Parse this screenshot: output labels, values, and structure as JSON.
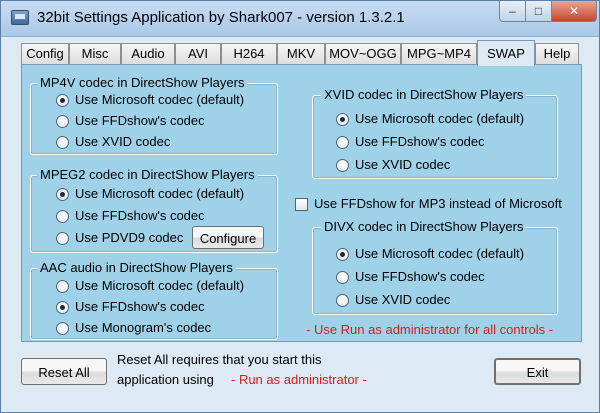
{
  "window": {
    "title": "32bit Settings Application by Shark007 - version 1.3.2.1",
    "minimize_glyph": "–",
    "maximize_glyph": "□",
    "close_glyph": "✕"
  },
  "tabs": [
    {
      "label": "Config",
      "active": false
    },
    {
      "label": "Misc",
      "active": false
    },
    {
      "label": "Audio",
      "active": false
    },
    {
      "label": "AVI",
      "active": false
    },
    {
      "label": "H264",
      "active": false
    },
    {
      "label": "MKV",
      "active": false
    },
    {
      "label": "MOV~OGG",
      "active": false
    },
    {
      "label": "MPG~MP4",
      "active": false
    },
    {
      "label": "SWAP",
      "active": true
    },
    {
      "label": "Help",
      "active": false
    }
  ],
  "mp4v": {
    "title": "MP4V codec in DirectShow Players",
    "options": [
      {
        "label": "Use Microsoft codec (default)",
        "checked": true
      },
      {
        "label": "Use FFDshow's codec",
        "checked": false
      },
      {
        "label": "Use XVID codec",
        "checked": false
      }
    ]
  },
  "mpeg2": {
    "title": "MPEG2 codec in DirectShow Players",
    "options": [
      {
        "label": "Use Microsoft codec (default)",
        "checked": true
      },
      {
        "label": "Use FFDshow's codec",
        "checked": false
      },
      {
        "label": "Use PDVD9 codec",
        "checked": false
      }
    ],
    "configure_label": "Configure"
  },
  "aac": {
    "title": "AAC audio in DirectShow Players",
    "options": [
      {
        "label": "Use Microsoft codec (default)",
        "checked": false
      },
      {
        "label": "Use FFDshow's codec",
        "checked": true
      },
      {
        "label": "Use Monogram's codec",
        "checked": false
      }
    ]
  },
  "xvid": {
    "title": "XVID codec in DirectShow Players",
    "options": [
      {
        "label": "Use Microsoft codec (default)",
        "checked": true
      },
      {
        "label": "Use FFDshow's codec",
        "checked": false
      },
      {
        "label": "Use XVID codec",
        "checked": false
      }
    ]
  },
  "mp3": {
    "label": "Use FFDshow for MP3 instead of Microsoft",
    "checked": false
  },
  "divx": {
    "title": "DIVX codec in DirectShow Players",
    "options": [
      {
        "label": "Use Microsoft codec (default)",
        "checked": true
      },
      {
        "label": "Use FFDshow's codec",
        "checked": false
      },
      {
        "label": "Use XVID codec",
        "checked": false
      }
    ]
  },
  "admin_note": "- Use Run as administrator for all controls -",
  "footer": {
    "reset_label": "Reset All",
    "info_line1": "Reset All requires that you start this",
    "info_line2": "application using",
    "info_red": "- Run as administrator -",
    "exit_label": "Exit"
  },
  "colors": {
    "panel_bg": "#9fd2e8",
    "window_bg": "#dde9f3",
    "note_red": "#e0191d"
  }
}
